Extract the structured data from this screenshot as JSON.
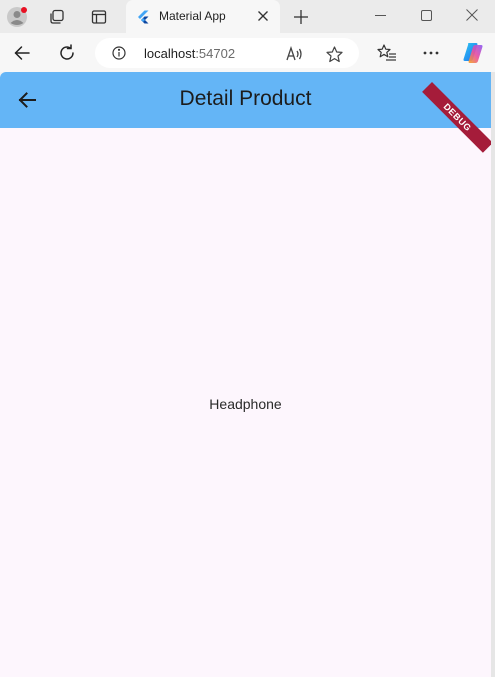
{
  "browser": {
    "tab": {
      "title": "Material App"
    },
    "address": {
      "host": "localhost",
      "port": ":54702"
    }
  },
  "app": {
    "appbar": {
      "title": "Detail Product",
      "color": "#64b5f6"
    },
    "debug_banner": "DEBUG",
    "body_text": "Headphone",
    "background": "#fdf6fd"
  },
  "icons": {
    "profile": "profile-icon",
    "workspaces": "workspaces-icon",
    "tab_actions": "tab-actions-icon",
    "favicon": "flutter-icon",
    "tab_close": "close-icon",
    "new_tab": "plus-icon",
    "minimize": "minimize-icon",
    "maximize": "maximize-icon",
    "window_close": "close-icon",
    "back": "back-arrow-icon",
    "reload": "reload-icon",
    "info": "info-icon",
    "read_aloud": "read-aloud-icon",
    "favorite": "star-icon",
    "favorites": "favorites-icon",
    "more": "more-icon",
    "copilot": "copilot-icon",
    "app_back": "arrow-back-icon"
  }
}
